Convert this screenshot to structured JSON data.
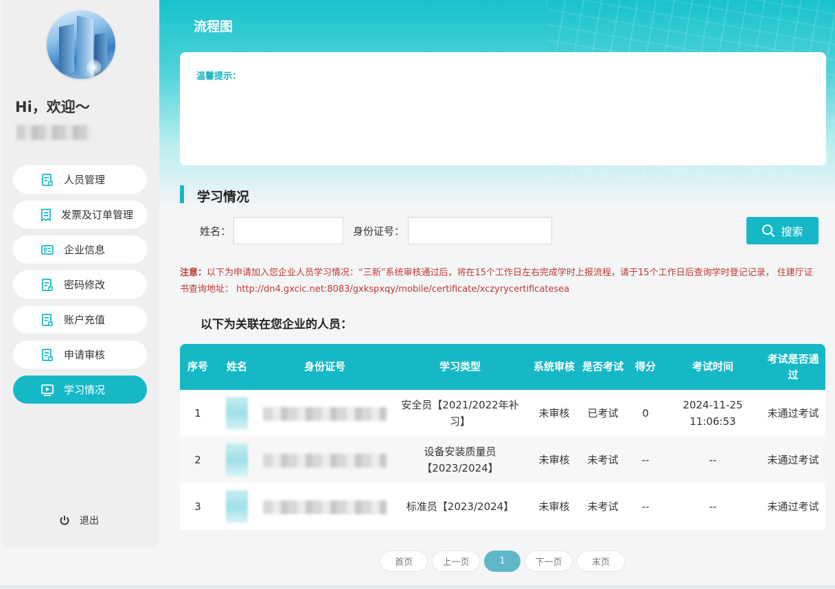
{
  "sidebar": {
    "greeting": "Hi，欢迎～",
    "items": [
      {
        "label": "人员管理",
        "icon": "user-doc-icon"
      },
      {
        "label": "发票及订单管理",
        "icon": "invoice-icon"
      },
      {
        "label": "企业信息",
        "icon": "id-card-icon"
      },
      {
        "label": "密码修改",
        "icon": "user-doc-icon"
      },
      {
        "label": "账户充值",
        "icon": "user-doc-icon"
      },
      {
        "label": "申请审核",
        "icon": "user-doc-icon"
      },
      {
        "label": "学习情况",
        "icon": "play-screen-icon",
        "active": true
      }
    ],
    "logout_label": "退出"
  },
  "header": {
    "title": "流程图"
  },
  "tip": {
    "label": "温馨提示："
  },
  "section": {
    "title": "学习情况"
  },
  "search": {
    "name_label": "姓名：",
    "name_value": "",
    "id_label": "身份证号：",
    "id_value": "",
    "button_label": "搜索"
  },
  "notice": {
    "prefix": "注意：",
    "text": "以下为申请加入您企业人员学习情况：“三新”系统审核通过后，将在15个工作日左右完成学时上报流程，请于15个工作日后查询学时登记记录， 住建厅证书查询地址： http://dn4.gxcic.net:8083/gxkspxqy/mobile/certificate/xczyrycertificatesea"
  },
  "related_title": "以下为关联在您企业的人员：",
  "table": {
    "headers": [
      "序号",
      "姓名",
      "身份证号",
      "学习类型",
      "系统审核",
      "是否考试",
      "得分",
      "考试时间",
      "考试是否通过"
    ],
    "rows": [
      {
        "no": "1",
        "study_type": "安全员【2021/2022年补习】",
        "audit": "未审核",
        "exam": "已考试",
        "score": "0",
        "exam_time": "2024-11-25 11:06:53",
        "passed": "未通过考试"
      },
      {
        "no": "2",
        "study_type": "设备安装质量员【2023/2024】",
        "audit": "未审核",
        "exam": "未考试",
        "score": "--",
        "exam_time": "--",
        "passed": "未通过考试"
      },
      {
        "no": "3",
        "study_type": "标准员【2023/2024】",
        "audit": "未审核",
        "exam": "未考试",
        "score": "--",
        "exam_time": "--",
        "passed": "未通过考试"
      }
    ]
  },
  "pagination": {
    "first": "首页",
    "prev": "上一页",
    "current": "1",
    "next": "下一页",
    "last": "末页"
  },
  "colors": {
    "accent": "#17b8c6",
    "notice": "#c0392b"
  }
}
